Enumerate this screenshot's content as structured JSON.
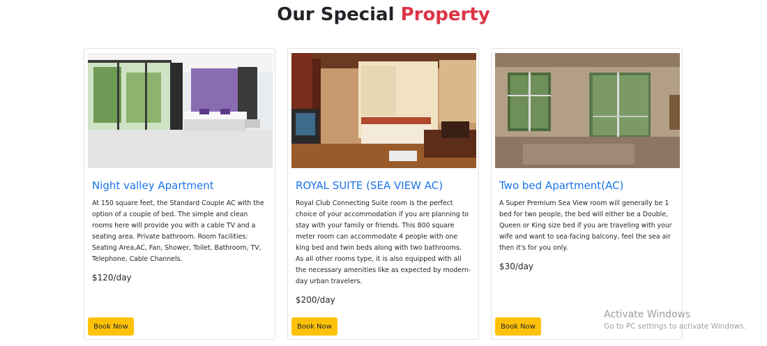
{
  "heading": {
    "prefix": "Our Special",
    "accent": "Property"
  },
  "cards": [
    {
      "image_label": "bedroom-photo",
      "title": "Night valley Apartment",
      "description": "At 150 square feet, the Standard Couple AC with the option of a couple of bed. The simple and clean rooms here will provide you with a cable TV and a seating area. Private bathroom. Room facilities: Seating Area,AC, Fan, Shower, Toilet, Bathroom, TV, Telephone, Cable Channels.",
      "price": "$120/day",
      "button": "Book Now"
    },
    {
      "image_label": "suite-photo",
      "title": "ROYAL SUITE (SEA VIEW AC)",
      "description": "Royal Club Connecting Suite room is the perfect choice of your accommodation if you are planning to stay with your family or friends. This 800 square meter room can accommodate 4 people with one king bed and twin beds along with two bathrooms. As all other rooms type, it is also equipped with all the necessary amenities like as expected by modern-day urban travelers.",
      "price": "$200/day",
      "button": "Book Now"
    },
    {
      "image_label": "empty-room-photo",
      "title": "Two bed Apartment(AC)",
      "description": "A Super Premium Sea View room will generally be 1 bed for two people, the bed will either be a Double, Queen or King size bed if you are traveling with your wife and want to sea-facing balcony, feel the sea air then it's for you only.",
      "price": "$30/day",
      "button": "Book Now"
    }
  ],
  "watermark": {
    "line1": "Activate Windows",
    "line2": "Go to PC settings to activate Windows."
  },
  "colors": {
    "accent": "#dc3545",
    "title": "#1a73e8",
    "button": "#ffc107"
  }
}
